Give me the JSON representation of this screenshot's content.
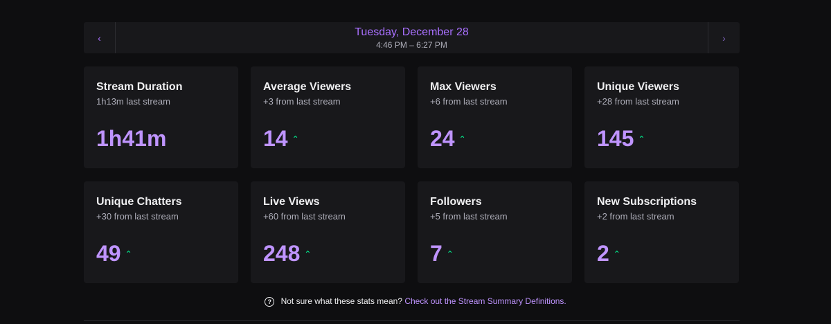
{
  "nav": {
    "prev_icon": "‹",
    "next_icon": "›",
    "date": "Tuesday, December 28",
    "time_range": "4:46 PM – 6:27 PM"
  },
  "cards": [
    {
      "title": "Stream Duration",
      "sub": "1h13m last stream",
      "value": "1h41m",
      "trend": ""
    },
    {
      "title": "Average Viewers",
      "sub": "+3 from last stream",
      "value": "14",
      "trend": "up"
    },
    {
      "title": "Max Viewers",
      "sub": "+6 from last stream",
      "value": "24",
      "trend": "up"
    },
    {
      "title": "Unique Viewers",
      "sub": "+28 from last stream",
      "value": "145",
      "trend": "up"
    },
    {
      "title": "Unique Chatters",
      "sub": "+30 from last stream",
      "value": "49",
      "trend": "up"
    },
    {
      "title": "Live Views",
      "sub": "+60 from last stream",
      "value": "248",
      "trend": "up"
    },
    {
      "title": "Followers",
      "sub": "+5 from last stream",
      "value": "7",
      "trend": "up"
    },
    {
      "title": "New Subscriptions",
      "sub": "+2 from last stream",
      "value": "2",
      "trend": "up"
    }
  ],
  "footer": {
    "help_icon": "?",
    "question": "Not sure what these stats mean?",
    "link": "Check out the Stream Summary Definitions."
  },
  "colors": {
    "accent": "#bf94ff",
    "date_accent": "#a970ff",
    "trend_up": "#00f593",
    "card_bg": "#18181b",
    "page_bg": "#0e0e10"
  }
}
